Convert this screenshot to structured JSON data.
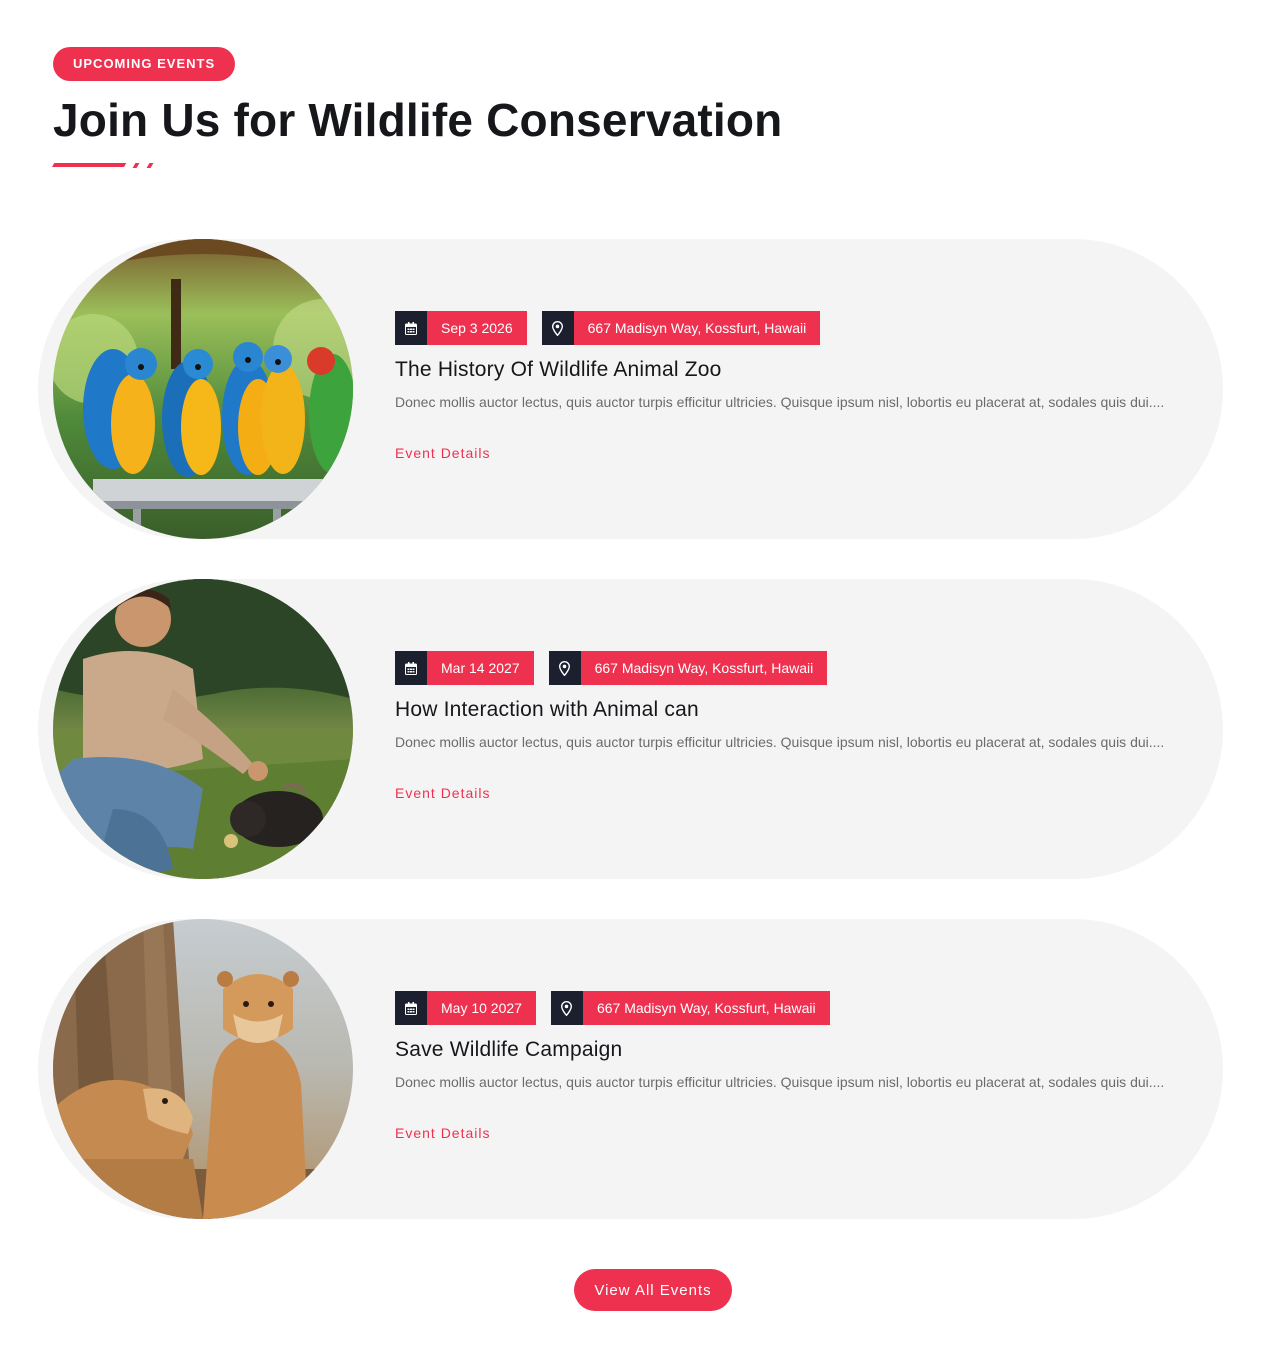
{
  "section": {
    "tag": "UPCOMING EVENTS",
    "title": "Join Us for Wildlife Conservation"
  },
  "events": [
    {
      "date": "Sep 3 2026",
      "location": "667 Madisyn Way, Kossfurt, Hawaii",
      "title": "The History Of Wildlife Animal Zoo",
      "description": "Donec mollis auctor lectus, quis auctor turpis efficitur ultricies. Quisque ipsum nisl, lobortis eu placerat at, sodales quis dui....",
      "link": "Event Details",
      "image": "parrots-photo"
    },
    {
      "date": "Mar 14 2027",
      "location": "667 Madisyn Way, Kossfurt, Hawaii",
      "title": "How Interaction with Animal can",
      "description": "Donec mollis auctor lectus, quis auctor turpis efficitur ultricies. Quisque ipsum nisl, lobortis eu placerat at, sodales quis dui....",
      "link": "Event Details",
      "image": "man-with-animal-photo"
    },
    {
      "date": "May 10 2027",
      "location": "667 Madisyn Way, Kossfurt, Hawaii",
      "title": "Save Wildlife Campaign",
      "description": "Donec mollis auctor lectus, quis auctor turpis efficitur ultricies. Quisque ipsum nisl, lobortis eu placerat at, sodales quis dui....",
      "link": "Event Details",
      "image": "lionesses-photo"
    }
  ],
  "cta": {
    "label": "View All Events"
  },
  "icons": {
    "date": "calendar-icon",
    "location": "map-pin-icon"
  },
  "colors": {
    "accent": "#ef3150",
    "dark": "#1b1f2e",
    "card_bg": "#f4f4f4",
    "heading": "#16171b",
    "body_text": "#6b6b6b"
  }
}
